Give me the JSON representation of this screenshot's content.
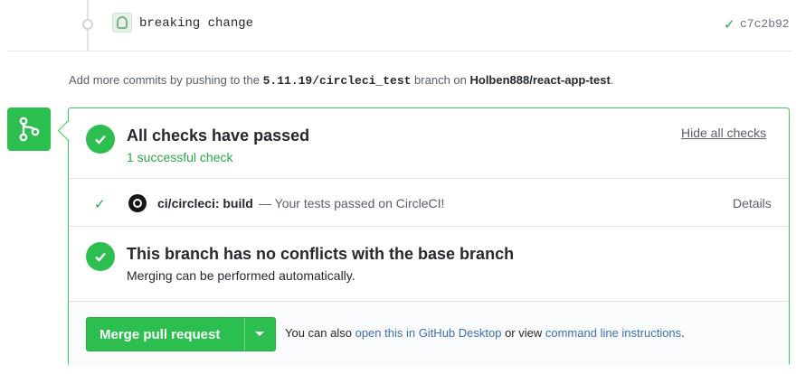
{
  "commit": {
    "message": "breaking change",
    "sha": "c7c2b92",
    "status_icon": "check-icon"
  },
  "hint": {
    "prefix": "Add more commits by pushing to the ",
    "branch": "5.11.19/circleci_test",
    "middle": " branch on ",
    "repo": "Holben888/react-app-test",
    "suffix": "."
  },
  "checks": {
    "title": "All checks have passed",
    "subtitle": "1 successful check",
    "toggle_label": "Hide all checks",
    "items": [
      {
        "name": "ci/circleci: build",
        "description": "— Your tests passed on CircleCI!",
        "details_label": "Details"
      }
    ]
  },
  "conflicts": {
    "title": "This branch has no conflicts with the base branch",
    "subtitle": "Merging can be performed automatically."
  },
  "merge": {
    "button_label": "Merge pull request",
    "also_prefix": "You can also ",
    "desktop_link": "open this in GitHub Desktop",
    "or_view": " or view ",
    "cli_link": "command line instructions",
    "suffix": "."
  },
  "colors": {
    "success": "#2cbe4e",
    "border": "#34d058",
    "link": "#3f6fb5"
  }
}
